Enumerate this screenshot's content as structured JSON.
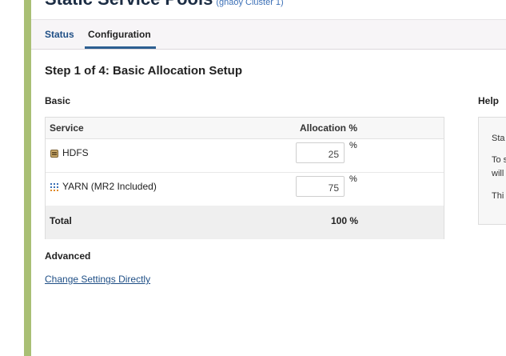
{
  "page": {
    "title": "Static Service Pools",
    "subtitle": "(gnaoy Cluster 1)"
  },
  "tabs": [
    {
      "label": "Status"
    },
    {
      "label": "Configuration"
    }
  ],
  "step_title": "Step 1 of 4: Basic Allocation Setup",
  "basic": {
    "heading": "Basic",
    "columns": {
      "service": "Service",
      "allocation": "Allocation %"
    },
    "rows": [
      {
        "service": "HDFS",
        "icon": "hdfs-icon",
        "value": "25",
        "unit": "%"
      },
      {
        "service": "YARN (MR2 Included)",
        "icon": "yarn-icon",
        "value": "75",
        "unit": "%"
      }
    ],
    "total_label": "Total",
    "total_value": "100 %"
  },
  "advanced": {
    "heading": "Advanced",
    "link": "Change Settings Directly"
  },
  "help": {
    "heading": "Help",
    "lines": [
      "Sta",
      "To s",
      "will",
      "Thi"
    ]
  },
  "colors": {
    "rail": "#a9bf74",
    "link": "#1f4f86",
    "tab_underline": "#2d5f91"
  }
}
